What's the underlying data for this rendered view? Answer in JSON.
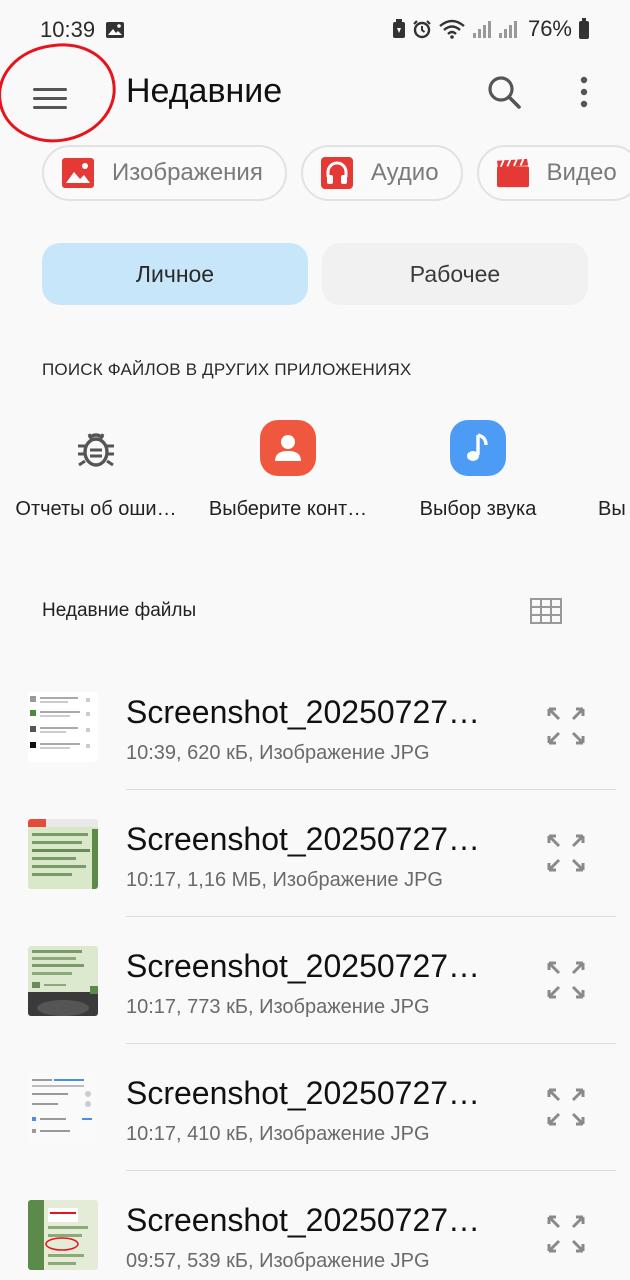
{
  "status_bar": {
    "time": "10:39",
    "battery": "76%"
  },
  "app_bar": {
    "title": "Недавние"
  },
  "chips": [
    {
      "label": "Изображения",
      "icon": "image-icon",
      "color": "#e53935"
    },
    {
      "label": "Аудио",
      "icon": "headphones-icon",
      "color": "#e53935"
    },
    {
      "label": "Видео",
      "icon": "video-icon",
      "color": "#e53935"
    }
  ],
  "tabs": [
    {
      "label": "Личное",
      "active": true
    },
    {
      "label": "Рабочее",
      "active": false
    }
  ],
  "search_section": {
    "title": "ПОИСК ФАЙЛОВ В ДРУГИХ ПРИЛОЖЕНИЯХ",
    "apps": [
      {
        "label": "Отчеты об оши…",
        "icon": "bug-icon"
      },
      {
        "label": "Выберите конт…",
        "icon": "contact-icon",
        "color": "#f0573f"
      },
      {
        "label": "Выбор звука",
        "icon": "music-note-icon",
        "color": "#4c9bf5"
      },
      {
        "label": "Вы",
        "icon": "none"
      }
    ]
  },
  "recent_files": {
    "title": "Недавние файлы",
    "items": [
      {
        "name": "Screenshot_20250727…",
        "meta": "10:39, 620 кБ, Изображение JPG"
      },
      {
        "name": "Screenshot_20250727…",
        "meta": "10:17, 1,16 МБ, Изображение JPG"
      },
      {
        "name": "Screenshot_20250727…",
        "meta": "10:17, 773 кБ, Изображение JPG"
      },
      {
        "name": "Screenshot_20250727…",
        "meta": "10:17, 410 кБ, Изображение JPG"
      },
      {
        "name": "Screenshot_20250727…",
        "meta": "09:57, 539 кБ, Изображение JPG"
      }
    ]
  },
  "colors": {
    "accent_tab": "#c8e6fa",
    "annotation": "#e8141c",
    "icon_red": "#e53935"
  }
}
